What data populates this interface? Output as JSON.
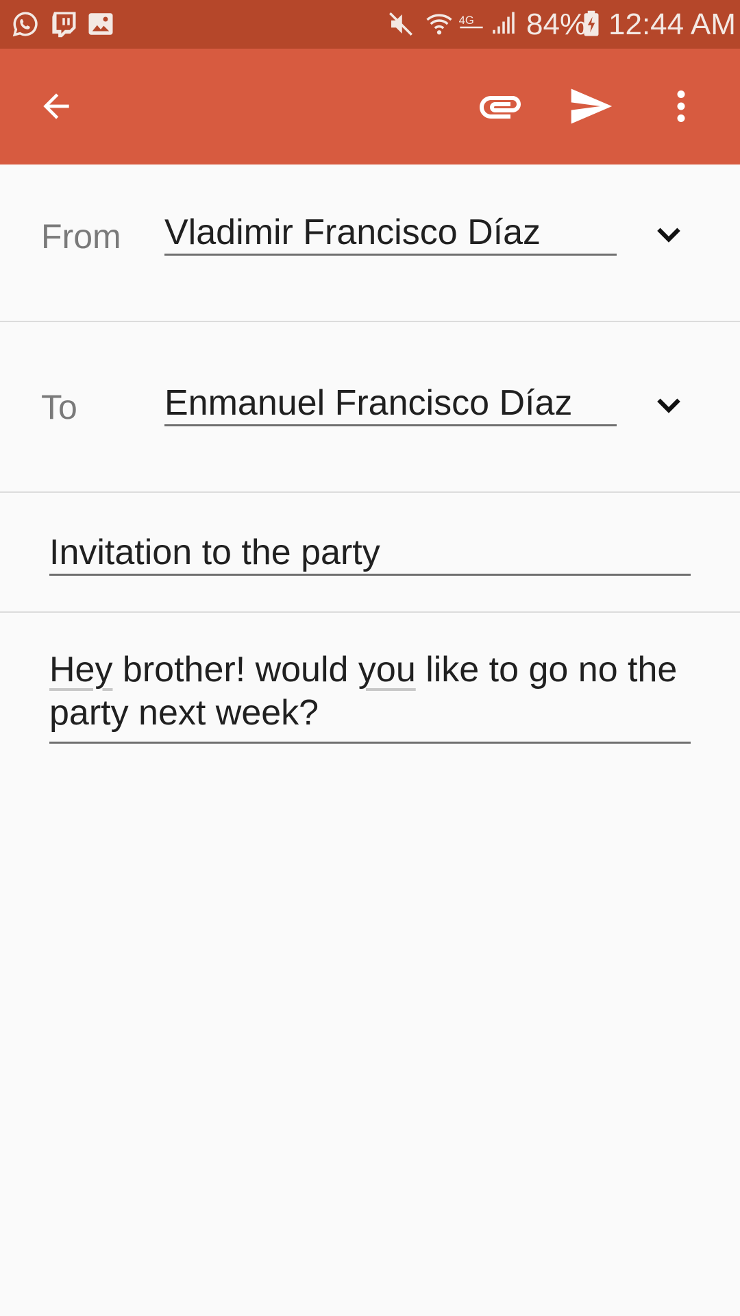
{
  "status_bar": {
    "battery": "84%",
    "time": "12:44 AM",
    "notification_icons": [
      "whatsapp-icon",
      "twitch-icon",
      "image-icon"
    ],
    "system_icons": [
      "mute-icon",
      "wifi-icon",
      "lte-icon",
      "signal-icon",
      "battery-charging-icon"
    ]
  },
  "app_bar": {
    "actions": [
      "back-arrow-icon",
      "attach-icon",
      "send-icon",
      "more-vert-icon"
    ]
  },
  "compose": {
    "from_label": "From",
    "from_value": "Vladimir Francisco Díaz",
    "to_label": "To",
    "to_value": "Enmanuel Francisco Díaz",
    "subject": "Invitation to the party",
    "body": {
      "w1": "Hey",
      "t1": " brother! would ",
      "w2": "you",
      "t2": " like to go no the party next week?"
    }
  },
  "colors": {
    "status_bar": "#b5472a",
    "app_bar": "#d75b40",
    "background": "#fafafa"
  }
}
